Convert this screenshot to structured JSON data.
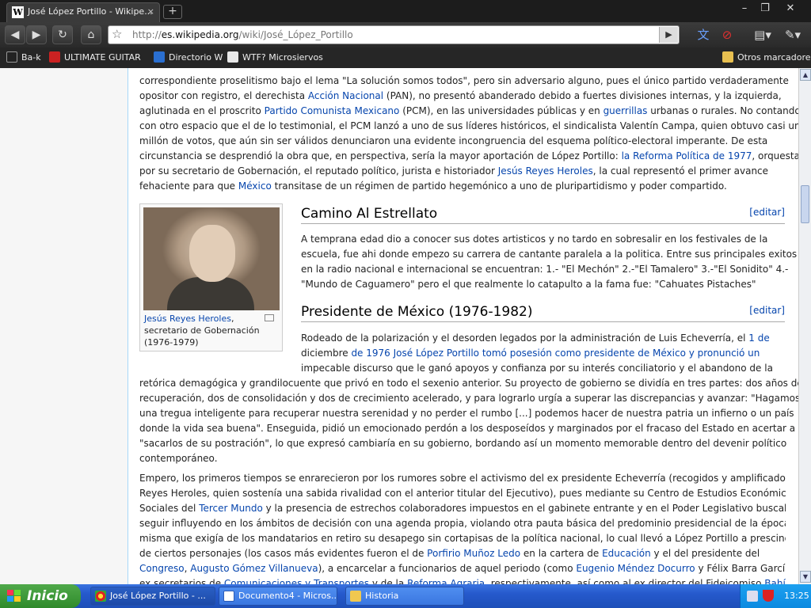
{
  "browser": {
    "tab_title": "José López Portillo - Wikipe...",
    "tab_close": "×",
    "new_tab": "+",
    "url_prefix": "http://",
    "url_domain": "es.wikipedia.org",
    "url_path": "/wiki/José_López_Portillo",
    "window_controls": [
      "–",
      "❐",
      "✕"
    ]
  },
  "bookmarks": {
    "items": [
      "Ba-k",
      "ULTIMATE GUITAR",
      "Directorio W",
      "WTF? Microsiervos"
    ],
    "other": "Otros marcadores"
  },
  "article": {
    "intro_lines": [
      "correspondiente proselitismo bajo el lema \"La solución somos todos\", pero sin adversario alguno, pues el único partido verdaderamente",
      "opositor con registro, el derechista |Acción Nacional| (PAN), no presentó abanderado debido a fuertes divisiones internas, y la izquierda,",
      "aglutinada en el proscrito |Partido Comunista Mexicano| (PCM), en las universidades públicas y en |guerrillas| urbanas o rurales. No contando",
      "con otro espacio que el de lo testimonial, el PCM lanzó a uno de sus líderes históricos, el sindicalista Valentín Campa, quien obtuvo casi un",
      "millón de votos, que aún sin ser válidos denunciaron una evidente incongruencia del esquema político-electoral imperante. De esta",
      "circunstancia se desprendió la obra que, en perspectiva, sería la mayor aportación de López Portillo: |la Reforma Política de 1977|, orquestada",
      "por su secretario de Gobernación, el reputado político, jurista e historiador |Jesús Reyes Heroles|, la cual representó el primer avance",
      "fehaciente para que |México| transitase de un régimen de partido hegemónico a uno de pluripartidismo y poder compartido."
    ],
    "section1": {
      "title": "Camino Al Estrellato",
      "edit": "[editar]",
      "lines": [
        "A temprana edad dio a conocer sus dotes artisticos y no tardo en sobresalir en los festivales de la",
        "escuela, fue ahi donde empezo su carrera de cantante paralela a la politica. Entre sus principales exitos",
        "en la radio nacional e internacional se encuentran: 1.- \"El Mechón\" 2.-\"El Tamalero\" 3.-\"El Sonidito\" 4.-",
        "\"Mundo de Caguamero\" pero el que realmente lo catapulto a la fama fue: \"Cahuates Pistaches\""
      ]
    },
    "section2": {
      "title": "Presidente de México (1976-1982)",
      "edit": "[editar]",
      "lines_narrow": [
        "Rodeado de la polarización y el desorden legados por la administración de Luis Echeverría, el |1 de",
        "diciembre| de 1976 José López Portillo tomó posesión como presidente de México y pronunció un",
        "impecable discurso que le ganó apoyos y confianza por su interés conciliatorio y el abandono de la"
      ],
      "lines_wide": [
        "retórica demagógica y grandilocuente que privó en todo el sexenio anterior. Su proyecto de gobierno se dividía en tres partes: dos años de",
        "recuperación, dos de consolidación y dos de crecimiento acelerado, y para lograrlo urgía a superar las discrepancias y avanzar: \"Hagamos",
        "una tregua inteligente para recuperar nuestra serenidad y no perder el rumbo [...] podemos hacer de nuestra patria un infierno o un país",
        "donde la vida sea buena\". Enseguida, pidió un emocionado perdón a los desposeídos y marginados por el fracaso del Estado en acertar a",
        "\"sacarlos de su postración\", lo que expresó cambiaría en su gobierno, bordando así un momento memorable dentro del devenir político",
        "contemporáneo."
      ],
      "para2_lines": [
        "Empero, los primeros tiempos se enrarecieron por los rumores sobre el activismo del ex presidente Echeverría (recogidos y amplificados por",
        "Reyes Heroles, quien sostenía una sabida rivalidad con el anterior titular del Ejecutivo), pues mediante su Centro de Estudios Económicos y",
        "Sociales del |Tercer Mundo| y la presencia de estrechos colaboradores impuestos en el gabinete entrante y en el Poder Legislativo buscaba",
        "seguir influyendo en los ámbitos de decisión con una agenda propia, violando otra pauta básica del predominio presidencial de la época,",
        "misma que exigía de los mandatarios en retiro su desapego sin cortapisas de la política nacional, lo cual llevó a López Portillo a prescindir",
        "de ciertos personajes (los casos más evidentes fueron el de |Porfirio Muñoz Ledo| en la cartera de |Educación| y el del presidente del",
        "|Congreso|, |Augusto Gómez Villanueva|), a encarcelar a funcionarios de aquel periodo (como |Eugenio Méndez Docurro| y Félix Barra García,",
        "ex secretarios de |Comunicaciones y Transportes| y de la |Reforma Agraria|, respectivamente, así como al ex director del Fideicomiso |Bahía de"
      ]
    },
    "thumb": {
      "caption_link": "Jesús Reyes Heroles",
      "caption_rest": ", secretario de Gobernación (1976-1979)"
    }
  },
  "taskbar": {
    "start": "Inicio",
    "tasks": [
      "José López Portillo - ...",
      "Documento4 - Micros...",
      "Historia"
    ],
    "clock": "13:25"
  }
}
